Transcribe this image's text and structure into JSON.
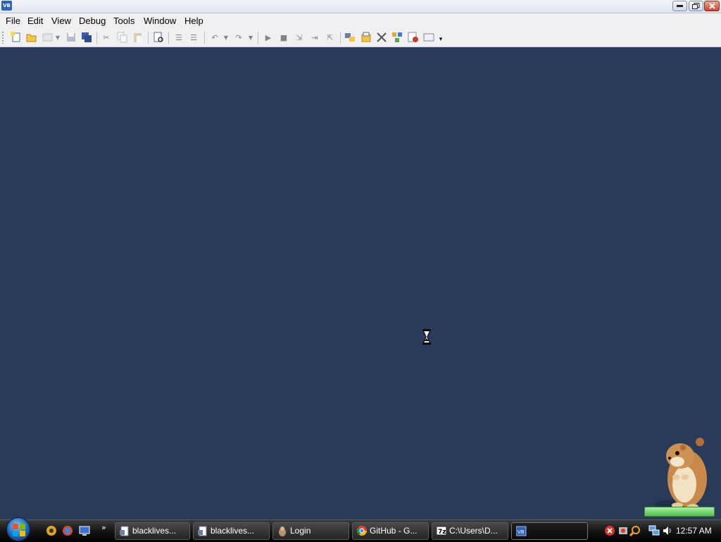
{
  "window": {
    "icon_text": "VB",
    "controls": {
      "minimize": "minimize",
      "maximize": "restore",
      "close": "close"
    }
  },
  "menubar": {
    "items": [
      {
        "id": "file",
        "label": "File"
      },
      {
        "id": "edit",
        "label": "Edit"
      },
      {
        "id": "view",
        "label": "View"
      },
      {
        "id": "debug",
        "label": "Debug"
      },
      {
        "id": "tools",
        "label": "Tools"
      },
      {
        "id": "window",
        "label": "Window"
      },
      {
        "id": "help",
        "label": "Help"
      }
    ]
  },
  "toolbar": {
    "buttons": [
      {
        "name": "new-project-icon",
        "enabled": true
      },
      {
        "name": "open-folder-icon",
        "enabled": true
      },
      {
        "name": "add-item-icon",
        "enabled": false
      },
      {
        "name": "save-icon",
        "enabled": false
      },
      {
        "name": "save-all-icon",
        "enabled": false
      },
      {
        "name": "cut-icon",
        "enabled": false
      },
      {
        "name": "copy-icon",
        "enabled": false
      },
      {
        "name": "paste-icon",
        "enabled": false
      },
      {
        "name": "find-icon",
        "enabled": true
      },
      {
        "name": "comment-icon",
        "enabled": false
      },
      {
        "name": "uncomment-icon",
        "enabled": false
      },
      {
        "name": "undo-icon",
        "enabled": false
      },
      {
        "name": "redo-icon",
        "enabled": false
      },
      {
        "name": "start-debug-icon",
        "enabled": false
      },
      {
        "name": "stop-debug-icon",
        "enabled": false
      },
      {
        "name": "step-into-icon",
        "enabled": false
      },
      {
        "name": "step-over-icon",
        "enabled": false
      },
      {
        "name": "step-out-icon",
        "enabled": false
      },
      {
        "name": "solution-explorer-icon",
        "enabled": true
      },
      {
        "name": "properties-icon",
        "enabled": true
      },
      {
        "name": "toolbox-icon",
        "enabled": true
      },
      {
        "name": "object-browser-icon",
        "enabled": true
      },
      {
        "name": "error-list-icon",
        "enabled": true
      },
      {
        "name": "window-layout-icon",
        "enabled": true
      }
    ]
  },
  "taskbar": {
    "tasks": [
      {
        "label": "blacklives...",
        "icon": "document-icon"
      },
      {
        "label": "blacklives...",
        "icon": "document-icon"
      },
      {
        "label": "Login",
        "icon": "app-icon"
      },
      {
        "label": "GitHub - G...",
        "icon": "chrome-icon"
      },
      {
        "label": "C:\\Users\\D...",
        "icon": "7zip-icon"
      },
      {
        "label": "",
        "icon": "vb-icon",
        "active": true
      }
    ],
    "clock": "12:57 AM"
  },
  "colors": {
    "workspace": "#2a3a5a",
    "chrome_bg": "#f0f0f0",
    "taskbar": "#111111",
    "hamster_bar": "#4fbf48"
  }
}
